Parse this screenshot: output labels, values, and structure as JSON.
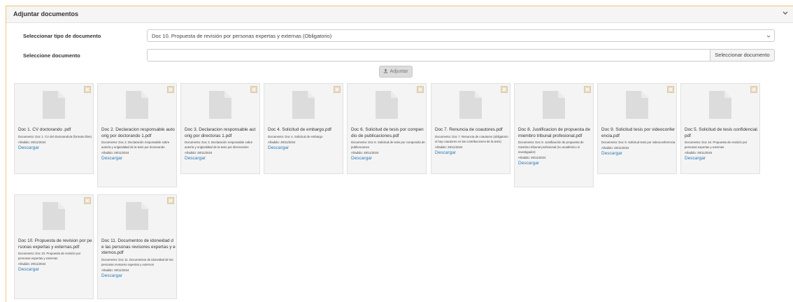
{
  "panel": {
    "title": "Adjuntar documentos",
    "collapse_icon": "chevron-down-icon"
  },
  "form": {
    "type_label": "Seleccionar tipo de documento",
    "type_selected": "Doc 10. Propuesta de revisión por personas expertas y externas (Obligatorio)",
    "file_label": "Seleccione documento",
    "file_value": "",
    "file_button": "Seleccionar documento",
    "upload_button": "Adjuntar"
  },
  "documents": [
    {
      "filename": "Doc 1. CV doctorando .pdf",
      "description": "Documento: Doc 1. CV del doctorando/a (formato libre)",
      "added": "Añadido: 29/11/2024",
      "download": "Descargar"
    },
    {
      "filename": "Doc 2. Declaracion responsable auto orig por doctorando 1.pdf",
      "description": "Documento: Doc 2. Declaración responsable sobre autoría y originalidad de la tesis por doctorando",
      "added": "Añadido: 29/11/2024",
      "download": "Descargar"
    },
    {
      "filename": "Doc 3. Declaracion responsable aut orig por directoras 1.pdf",
      "description": "Documento: Doc 3. Declaración responsable sobre autoría y originalidad de la tesis por directora/es",
      "added": "Añadido: 29/11/2024",
      "download": "Descargar"
    },
    {
      "filename": "Doc 4. Solicitud de embargo.pdf",
      "description": "Documento: Doc 4. Solicitud de embargo",
      "added": "Añadido: 29/11/2024",
      "download": "Descargar"
    },
    {
      "filename": "Doc 6. Solicitud de tesis por compendio de publicaciones.pdf",
      "description": "Documento: Doc 6. Solicitud de tesis por compendio de publicaciones",
      "added": "Añadido: 29/11/2024",
      "download": "Descargar"
    },
    {
      "filename": "Doc 7. Renuncia de coautores.pdf",
      "description": "Documento: Doc 7. Renuncia de coautores (obligatorio si hay coautores en las contribuciones de la tesis)",
      "added": "Añadido: 29/11/2024",
      "download": "Descargar"
    },
    {
      "filename": "Doc 8. Justificacion de propuesta de miembro tribunal profesional.pdf",
      "description": "Documento: Doc 8. Justificación de propuesta de miembro tribunal profesional (no académico ni investigador)",
      "added": "Añadido: 29/11/2024",
      "download": "Descargar"
    },
    {
      "filename": "Doc 9. Solicitud tesis por videoconferencia.pdf",
      "description": "Documento: Doc 9. Solicitud tesis por videoconferencia",
      "added": "Añadido: 29/11/2024",
      "download": "Descargar"
    },
    {
      "filename": "Doc 5. Solicitud de tesis confidencial.pdf",
      "description": "Documento: Doc 10. Propuesta de revisión por personas expertas y externas",
      "added": "Añadido: 29/11/2024",
      "download": "Descargar"
    },
    {
      "filename": "Doc 10. Propuesta de revision por personas expertas y externas.pdf",
      "description": "Documento: Doc 10. Propuesta de revisión por personas expertas y externas",
      "added": "Añadido: 29/11/2024",
      "download": "Descargar"
    },
    {
      "filename": "Doc 11. Documentos de idoneidad de las personas revisores expertas y externos.pdf",
      "description": "Documento: Doc 11. Documentos de idoneidad de las personas revisores expertas y externos",
      "added": "Añadido: 29/11/2024",
      "download": "Descargar"
    }
  ],
  "icons": {
    "thumbnail": "file-icon",
    "remove": "close-icon",
    "upload": "upload-icon",
    "dropdown": "caret-down-icon"
  },
  "colors": {
    "panel_border": "#f0c770",
    "link": "#2a7ab8",
    "card_bg": "#f4f4f4",
    "close_btn": "#e9dcc2"
  }
}
